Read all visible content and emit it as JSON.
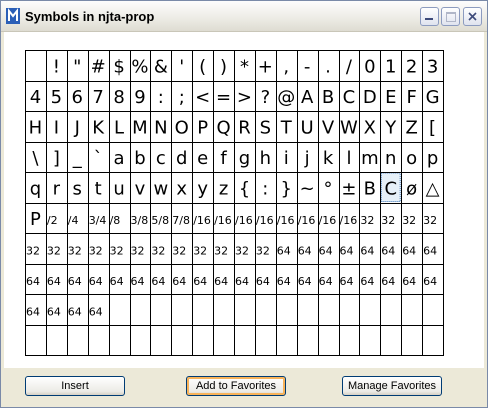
{
  "window": {
    "title": "Symbols in njta-prop"
  },
  "cells": [
    "",
    "!",
    "\"",
    "#",
    "$",
    "%",
    "&",
    "'",
    "(",
    ")",
    "*",
    "+",
    ",",
    "-",
    ".",
    "/",
    "0",
    "1",
    "2",
    "3",
    "4",
    "5",
    "6",
    "7",
    "8",
    "9",
    ":",
    ";",
    "<",
    "=",
    ">",
    "?",
    "@",
    "A",
    "B",
    "C",
    "D",
    "E",
    "F",
    "G",
    "H",
    "I",
    "J",
    "K",
    "L",
    "M",
    "N",
    "O",
    "P",
    "Q",
    "R",
    "S",
    "T",
    "U",
    "V",
    "W",
    "X",
    "Y",
    "Z",
    "[",
    "\\",
    "]",
    "_",
    "`",
    "a",
    "b",
    "c",
    "d",
    "e",
    "f",
    "g",
    "h",
    "i",
    "j",
    "k",
    "l",
    "m",
    "n",
    "o",
    "p",
    "q",
    "r",
    "s",
    "t",
    "u",
    "v",
    "w",
    "x",
    "y",
    "z",
    "{",
    ":",
    "}",
    "~",
    "°",
    "±",
    "B",
    "C",
    "ø",
    "△",
    "P",
    "/2",
    "/4",
    "3/4",
    "/8",
    "3/8",
    "5/8",
    "7/8",
    "/16",
    "/16",
    "/16",
    "/16",
    "/16",
    "/16",
    "/16",
    "/16",
    "32",
    "32",
    "32",
    "32",
    "32",
    "32",
    "32",
    "32",
    "32",
    "32",
    "32",
    "32",
    "32",
    "32",
    "32",
    "32",
    "64",
    "64",
    "64",
    "64",
    "64",
    "64",
    "64",
    "64",
    "64",
    "64",
    "64",
    "64",
    "64",
    "64",
    "64",
    "64",
    "64",
    "64",
    "64",
    "64",
    "64",
    "64",
    "64",
    "64",
    "64",
    "64",
    "64",
    "64",
    "64",
    "64",
    "64",
    "64",
    "",
    "",
    "",
    "",
    "",
    "",
    "",
    "",
    "",
    "",
    "",
    "",
    "",
    "",
    "",
    "",
    "",
    "",
    "",
    "",
    "",
    "",
    "",
    "",
    "",
    "",
    "",
    "",
    "",
    "",
    "",
    "",
    "",
    "",
    "",
    ""
  ],
  "selected_index": 97,
  "buttons": {
    "insert": "Insert",
    "add_favorites": "Add to Favorites",
    "manage_favorites": "Manage Favorites"
  },
  "colors": {
    "selection": "#e6f0f8",
    "selection_border": "#2f6db5",
    "grid": "#000000"
  }
}
